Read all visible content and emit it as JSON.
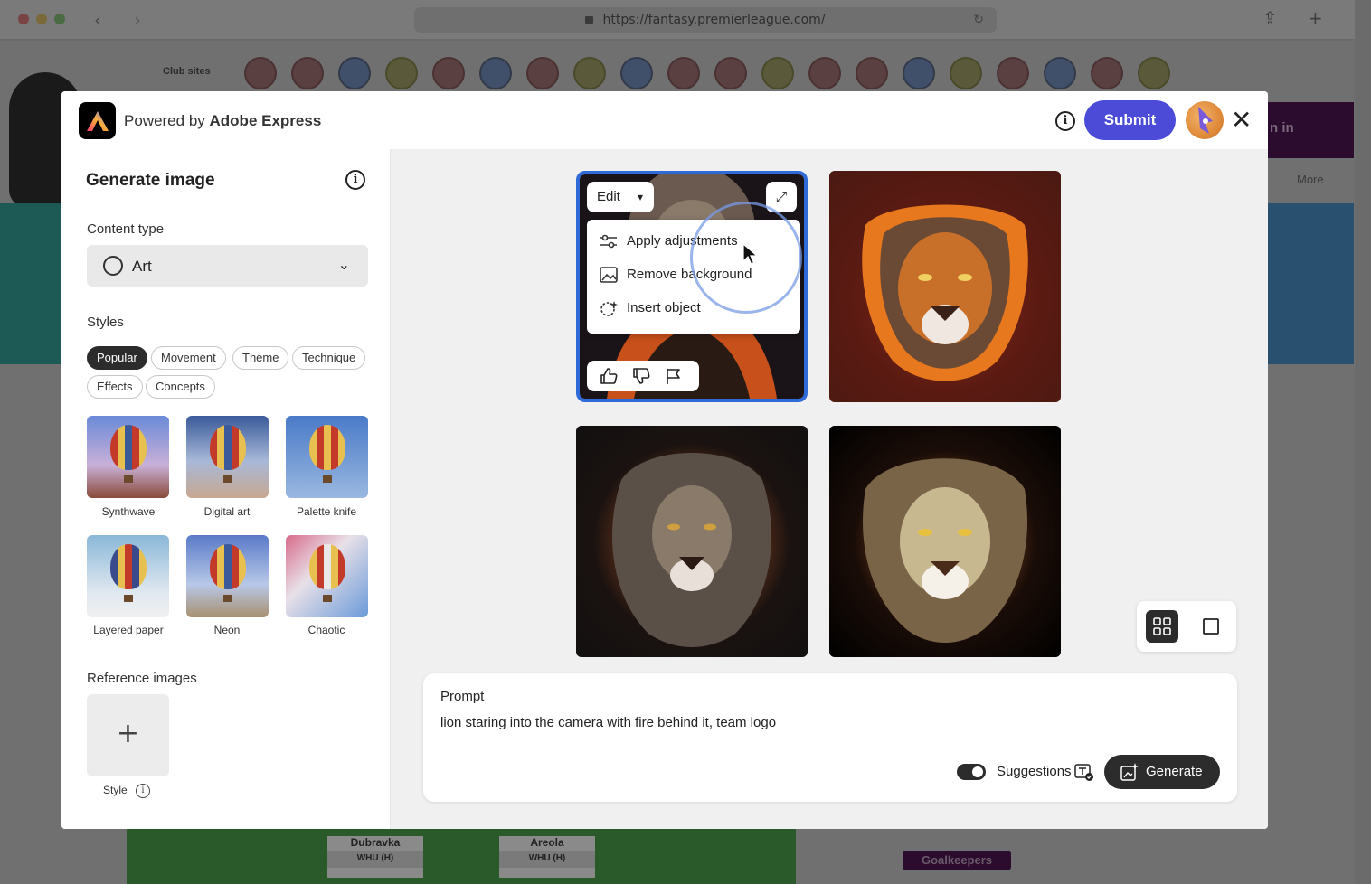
{
  "browser": {
    "url": "https://fantasy.premierleague.com/",
    "back_icon": "chevron-left-icon",
    "forward_icon": "chevron-right-icon",
    "share_icon": "share-icon",
    "new_tab_icon": "plus-icon"
  },
  "background_page": {
    "club_sites_label": "Club sites",
    "sign_in_fragment": "n in",
    "more_label": "More",
    "players": [
      {
        "name": "Dubravka",
        "team": "WHU (H)"
      },
      {
        "name": "Areola",
        "team": "WHU (H)"
      }
    ],
    "goalkeepers_label": "Goalkeepers"
  },
  "modal": {
    "powered_by_prefix": "Powered by",
    "powered_by_brand": "Adobe Express",
    "submit_label": "Submit",
    "colors": {
      "submit_bg": "#4b4bd8",
      "selected_border": "#2f6ad9",
      "dark_button": "#2c2c2c"
    }
  },
  "left_panel": {
    "title": "Generate image",
    "content_type_label": "Content type",
    "content_type_value": "Art",
    "styles_label": "Styles",
    "style_filters": [
      {
        "label": "Popular",
        "active": true
      },
      {
        "label": "Movement",
        "active": false
      },
      {
        "label": "Theme",
        "active": false
      },
      {
        "label": "Technique",
        "active": false
      },
      {
        "label": "Effects",
        "active": false
      },
      {
        "label": "Concepts",
        "active": false
      }
    ],
    "style_presets": [
      {
        "label": "Synthwave"
      },
      {
        "label": "Digital art"
      },
      {
        "label": "Palette knife"
      },
      {
        "label": "Layered paper"
      },
      {
        "label": "Neon"
      },
      {
        "label": "Chaotic"
      }
    ],
    "reference_images_label": "Reference images",
    "reference_style_label": "Style"
  },
  "results": {
    "edit_label": "Edit",
    "edit_menu": [
      {
        "label": "Apply adjustments",
        "icon": "sliders-icon"
      },
      {
        "label": "Remove background",
        "icon": "image-icon"
      },
      {
        "label": "Insert object",
        "icon": "sparkle-select-icon"
      }
    ],
    "feedback_icons": [
      "thumbs-up-icon",
      "thumbs-down-icon",
      "flag-icon"
    ]
  },
  "prompt": {
    "label": "Prompt",
    "text": "lion staring into the camera with fire behind it, team logo",
    "suggestions_label": "Suggestions",
    "suggestions_on": true,
    "generate_label": "Generate"
  }
}
